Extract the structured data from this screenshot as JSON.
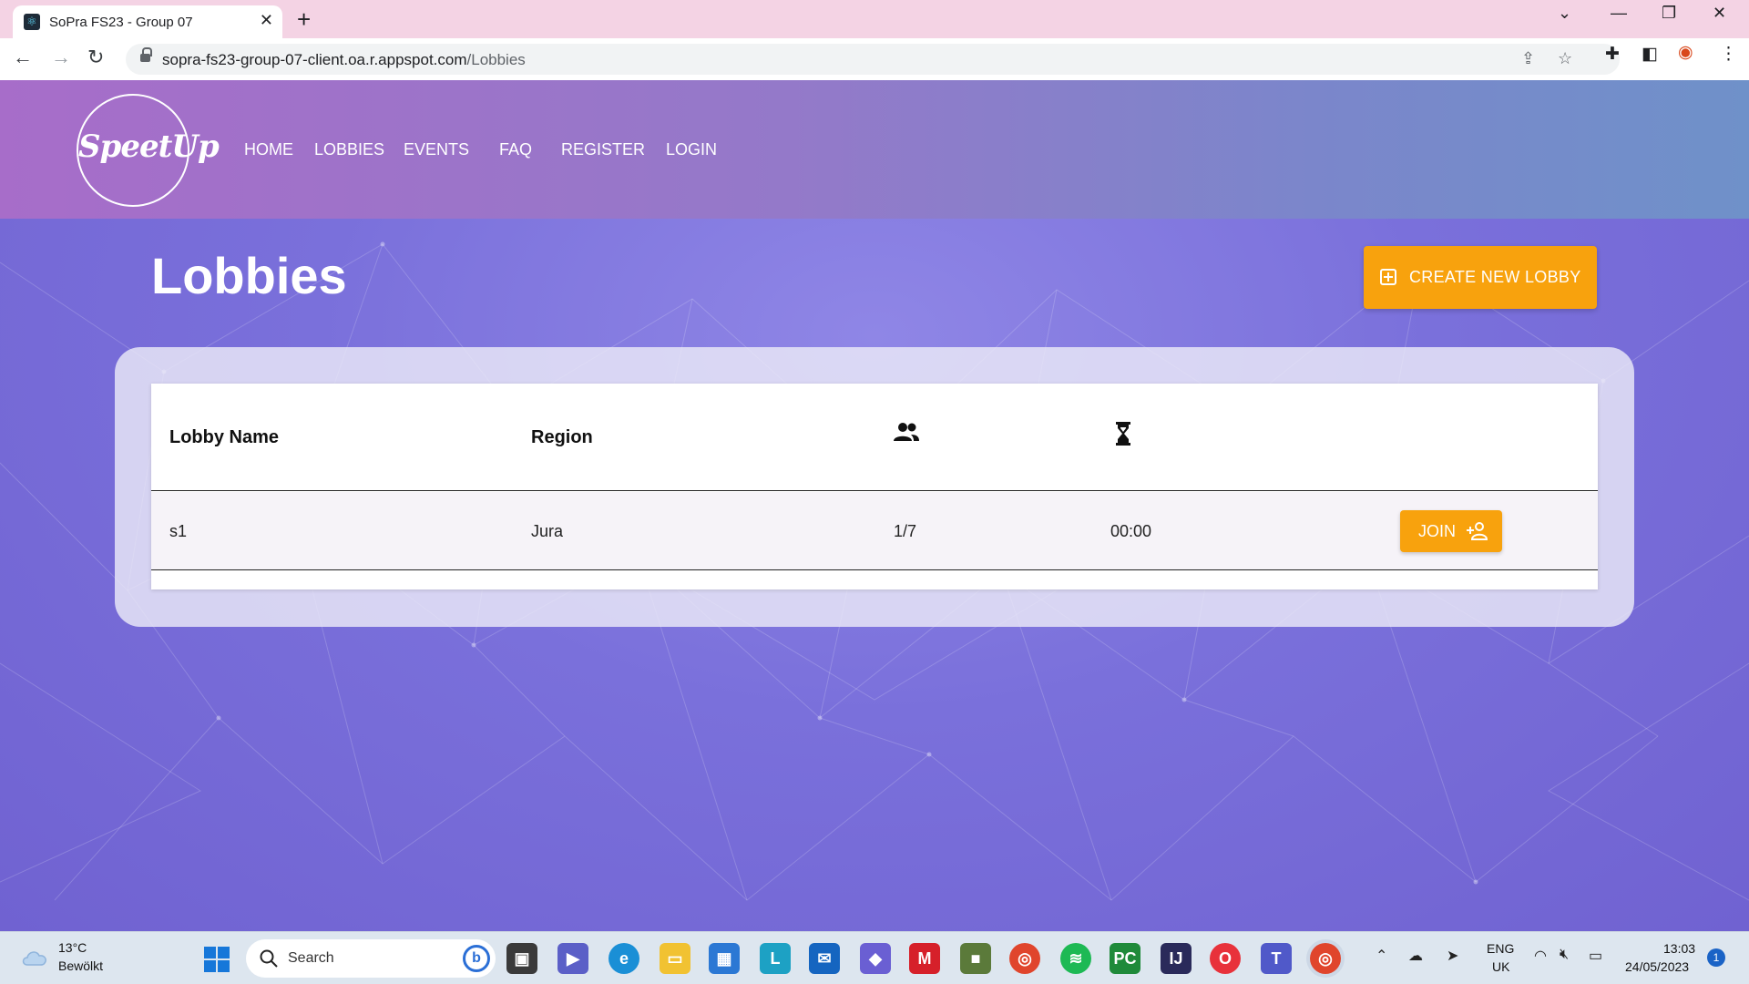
{
  "browser": {
    "tab_title": "SoPra FS23 - Group 07",
    "url_domain": "sopra-fs23-group-07-client.oa.r.appspot.com",
    "url_path": "/Lobbies"
  },
  "header": {
    "logo_text": "SpeetUp",
    "nav": [
      "HOME",
      "LOBBIES",
      "EVENTS",
      "FAQ",
      "REGISTER",
      "LOGIN"
    ]
  },
  "main": {
    "title": "Lobbies",
    "create_button_label": "CREATE NEW LOBBY",
    "table": {
      "headers": {
        "name": "Lobby Name",
        "region": "Region",
        "players_icon": "group-icon",
        "time_icon": "hourglass-icon"
      },
      "rows": [
        {
          "name": "s1",
          "region": "Jura",
          "players": "1/7",
          "time": "00:00",
          "action_label": "JOIN"
        }
      ]
    }
  },
  "taskbar": {
    "weather_temp": "13°C",
    "weather_desc": "Bewölkt",
    "search_placeholder": "Search",
    "lang_top": "ENG",
    "lang_bottom": "UK",
    "time": "13:03",
    "date": "24/05/2023",
    "notification_count": "1"
  },
  "colors": {
    "accent": "#f8a20d",
    "header_gradient_start": "#a76dc9",
    "header_gradient_end": "#6f91c9"
  }
}
